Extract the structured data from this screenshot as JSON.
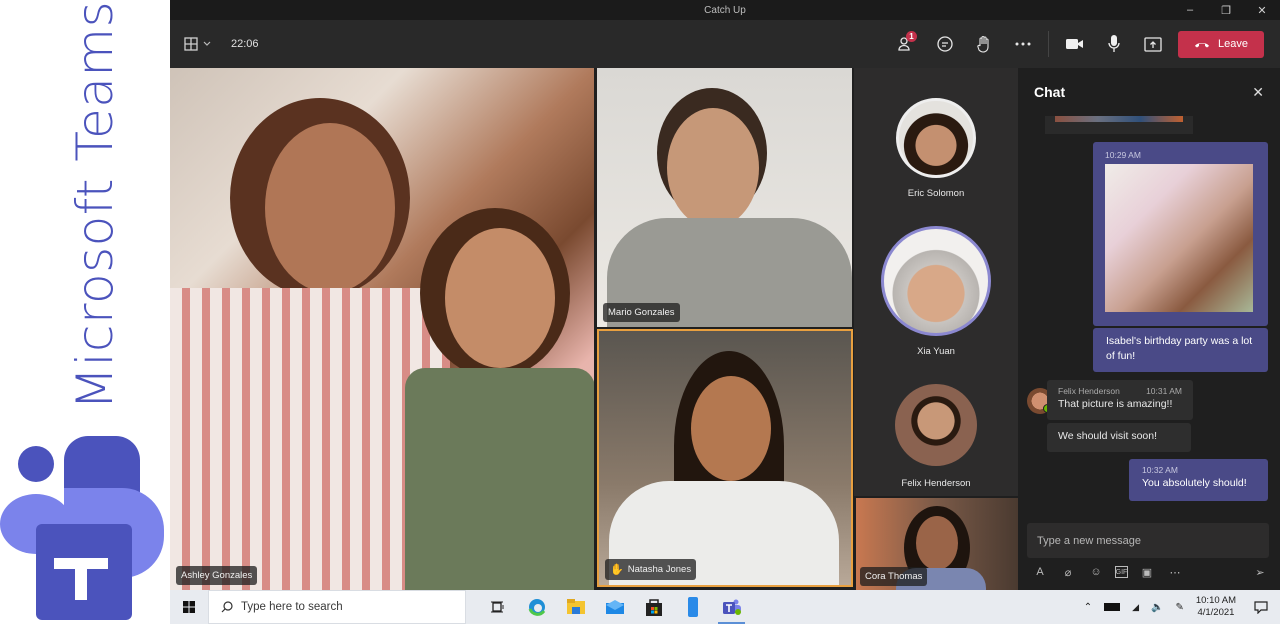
{
  "brand": {
    "wordmark": "Microsoft Teams",
    "color": "#4b53bc"
  },
  "window": {
    "title": "Catch Up",
    "minimize": "–",
    "restore": "❐",
    "close": "✕"
  },
  "toolbar": {
    "layout_icon": "grid-icon",
    "duration": "22:06",
    "participants_badge": "1",
    "buttons": [
      "people-icon",
      "chat-icon",
      "raise-hand-icon",
      "more-icon",
      "camera-icon",
      "mic-icon",
      "share-screen-icon"
    ],
    "leave_label": "Leave",
    "leave_color": "#c4314b"
  },
  "stage": {
    "tiles": [
      {
        "name": "Ashley Gonzales"
      },
      {
        "name": "Mario Gonzales"
      },
      {
        "name": "Natasha Jones",
        "hand_raised": true
      }
    ]
  },
  "roster": {
    "people": [
      {
        "name": "Eric Solomon"
      },
      {
        "name": "Xia Yuan",
        "speaking": true
      },
      {
        "name": "Felix Henderson"
      },
      {
        "name": "Cora Thomas",
        "video": true
      }
    ]
  },
  "chat": {
    "title": "Chat",
    "messages": [
      {
        "from": "me",
        "time": "10:29 AM",
        "type": "image"
      },
      {
        "from": "me",
        "text": "Isabel's birthday party was a lot of fun!"
      },
      {
        "from": "Felix Henderson",
        "time": "10:31 AM",
        "text": "That picture is amazing!!"
      },
      {
        "from": "Felix Henderson",
        "text": "We should visit soon!"
      },
      {
        "from": "me",
        "time": "10:32 AM",
        "text": "You absolutely should!"
      }
    ],
    "composer_placeholder": "Type a new message",
    "compose_tools": [
      "format-icon",
      "attach-icon",
      "emoji-icon",
      "gif-icon",
      "sticker-icon",
      "more-icon"
    ]
  },
  "taskbar": {
    "search_placeholder": "Type here to search",
    "apps": [
      "task-view-icon",
      "edge-icon",
      "file-explorer-icon",
      "mail-icon",
      "store-icon",
      "phone-icon",
      "teams-icon"
    ],
    "time": "10:10 AM",
    "date": "4/1/2021"
  }
}
